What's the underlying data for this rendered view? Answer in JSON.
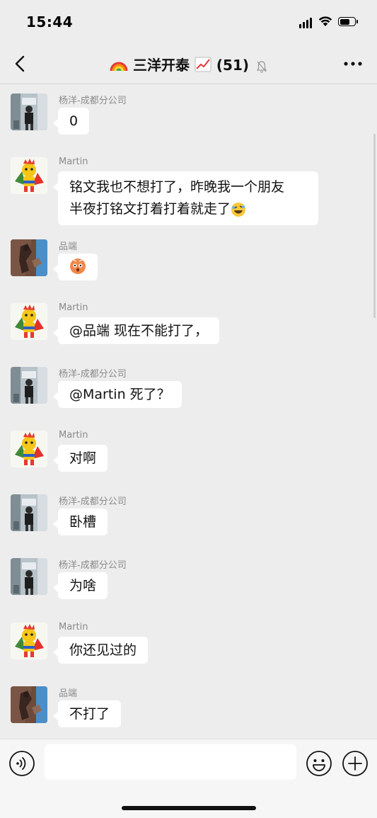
{
  "status": {
    "time": "15:44"
  },
  "nav": {
    "title": "三洋开泰",
    "member_count": "(51)"
  },
  "input": {
    "placeholder": ""
  },
  "messages": [
    {
      "sender": "杨洋-成都分公司",
      "text": "0"
    },
    {
      "sender": "Martin",
      "text_line1": "铭文我也不想打了，昨晚我一个朋友",
      "text_line2": "半夜打铭文打着打着就走了"
    },
    {
      "sender": "品端",
      "text": ""
    },
    {
      "sender": "Martin",
      "text": "@品端 现在不能打了，"
    },
    {
      "sender": "杨洋-成都分公司",
      "text": "@Martin 死了？"
    },
    {
      "sender": "Martin",
      "text": "对啊"
    },
    {
      "sender": "杨洋-成都分公司",
      "text": "卧槽"
    },
    {
      "sender": "杨洋-成都分公司",
      "text": "为啥"
    },
    {
      "sender": "Martin",
      "text": "你还见过的"
    },
    {
      "sender": "品端",
      "text": "不打了"
    }
  ],
  "colors": {
    "background": "#ededed",
    "bubble": "#ffffff",
    "sender": "#8a8a8a"
  }
}
